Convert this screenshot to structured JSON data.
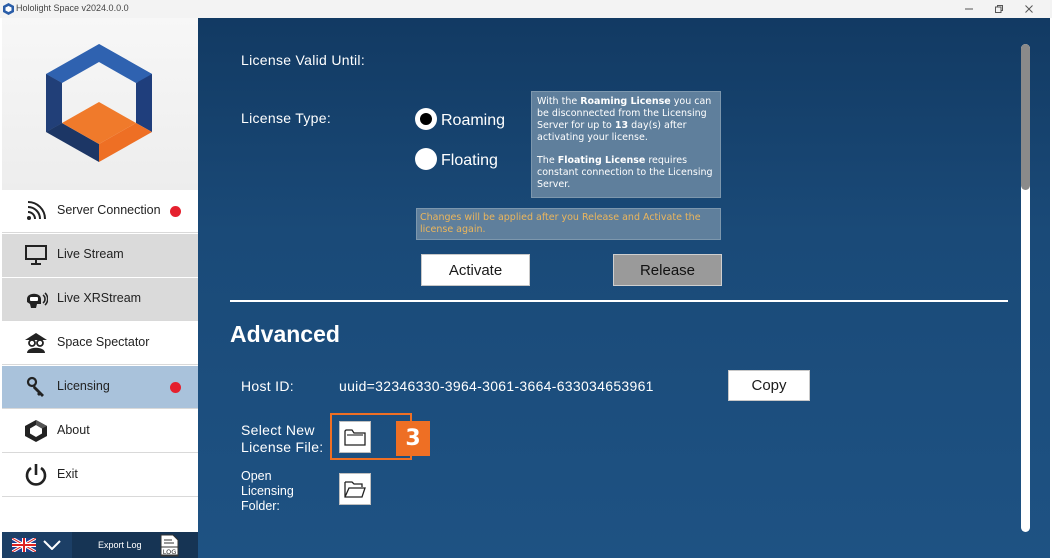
{
  "window": {
    "title": "Hololight Space v2024.0.0.0"
  },
  "sidebar": {
    "items": [
      {
        "label": "Server Connection",
        "icon": "signal-icon",
        "status": "red-dot"
      },
      {
        "label": "Live Stream",
        "icon": "monitor-icon"
      },
      {
        "label": "Live XRStream",
        "icon": "vr-headset-icon"
      },
      {
        "label": "Space Spectator",
        "icon": "spectator-icon"
      },
      {
        "label": "Licensing",
        "icon": "key-icon",
        "status": "red-dot"
      },
      {
        "label": "About",
        "icon": "hololight-logo-icon"
      },
      {
        "label": "Exit",
        "icon": "power-icon"
      }
    ],
    "footer": {
      "language": "uk-flag-icon",
      "export_log_label": "Export Log",
      "log_icon_text": "LOG"
    }
  },
  "license": {
    "valid_until_label": "License Valid Until:",
    "type_label": "License Type:",
    "options": [
      {
        "label": "Roaming",
        "selected": true
      },
      {
        "label": "Floating",
        "selected": false
      }
    ],
    "info": {
      "p1_a": "With the ",
      "p1_b": "Roaming License",
      "p1_c": " you can be disconnected from the Licensing Server for up to ",
      "p1_d": "13",
      "p1_e": " day(s) after activating your license.",
      "p2_a": "The ",
      "p2_b": "Floating License",
      "p2_c": " requires constant connection to the Licensing Server."
    },
    "warning": "Changes will be applied after you Release and Activate the license again.",
    "activate_label": "Activate",
    "release_label": "Release"
  },
  "advanced": {
    "heading": "Advanced",
    "host_id_label": "Host ID:",
    "host_id_value": "uuid=32346330-3964-3061-3664-633034653961",
    "copy_label": "Copy",
    "select_license_line1": "Select New",
    "select_license_line2": "License File:",
    "open_folder_line1": "Open",
    "open_folder_line2": "Licensing",
    "open_folder_line3": "Folder:",
    "step_number": "3"
  },
  "colors": {
    "panel_bg": "#1a4a78",
    "accent_orange": "#ee6f24",
    "status_red": "#e5202e",
    "active_nav": "#a9c2db",
    "warning_text": "#ecb65c"
  }
}
